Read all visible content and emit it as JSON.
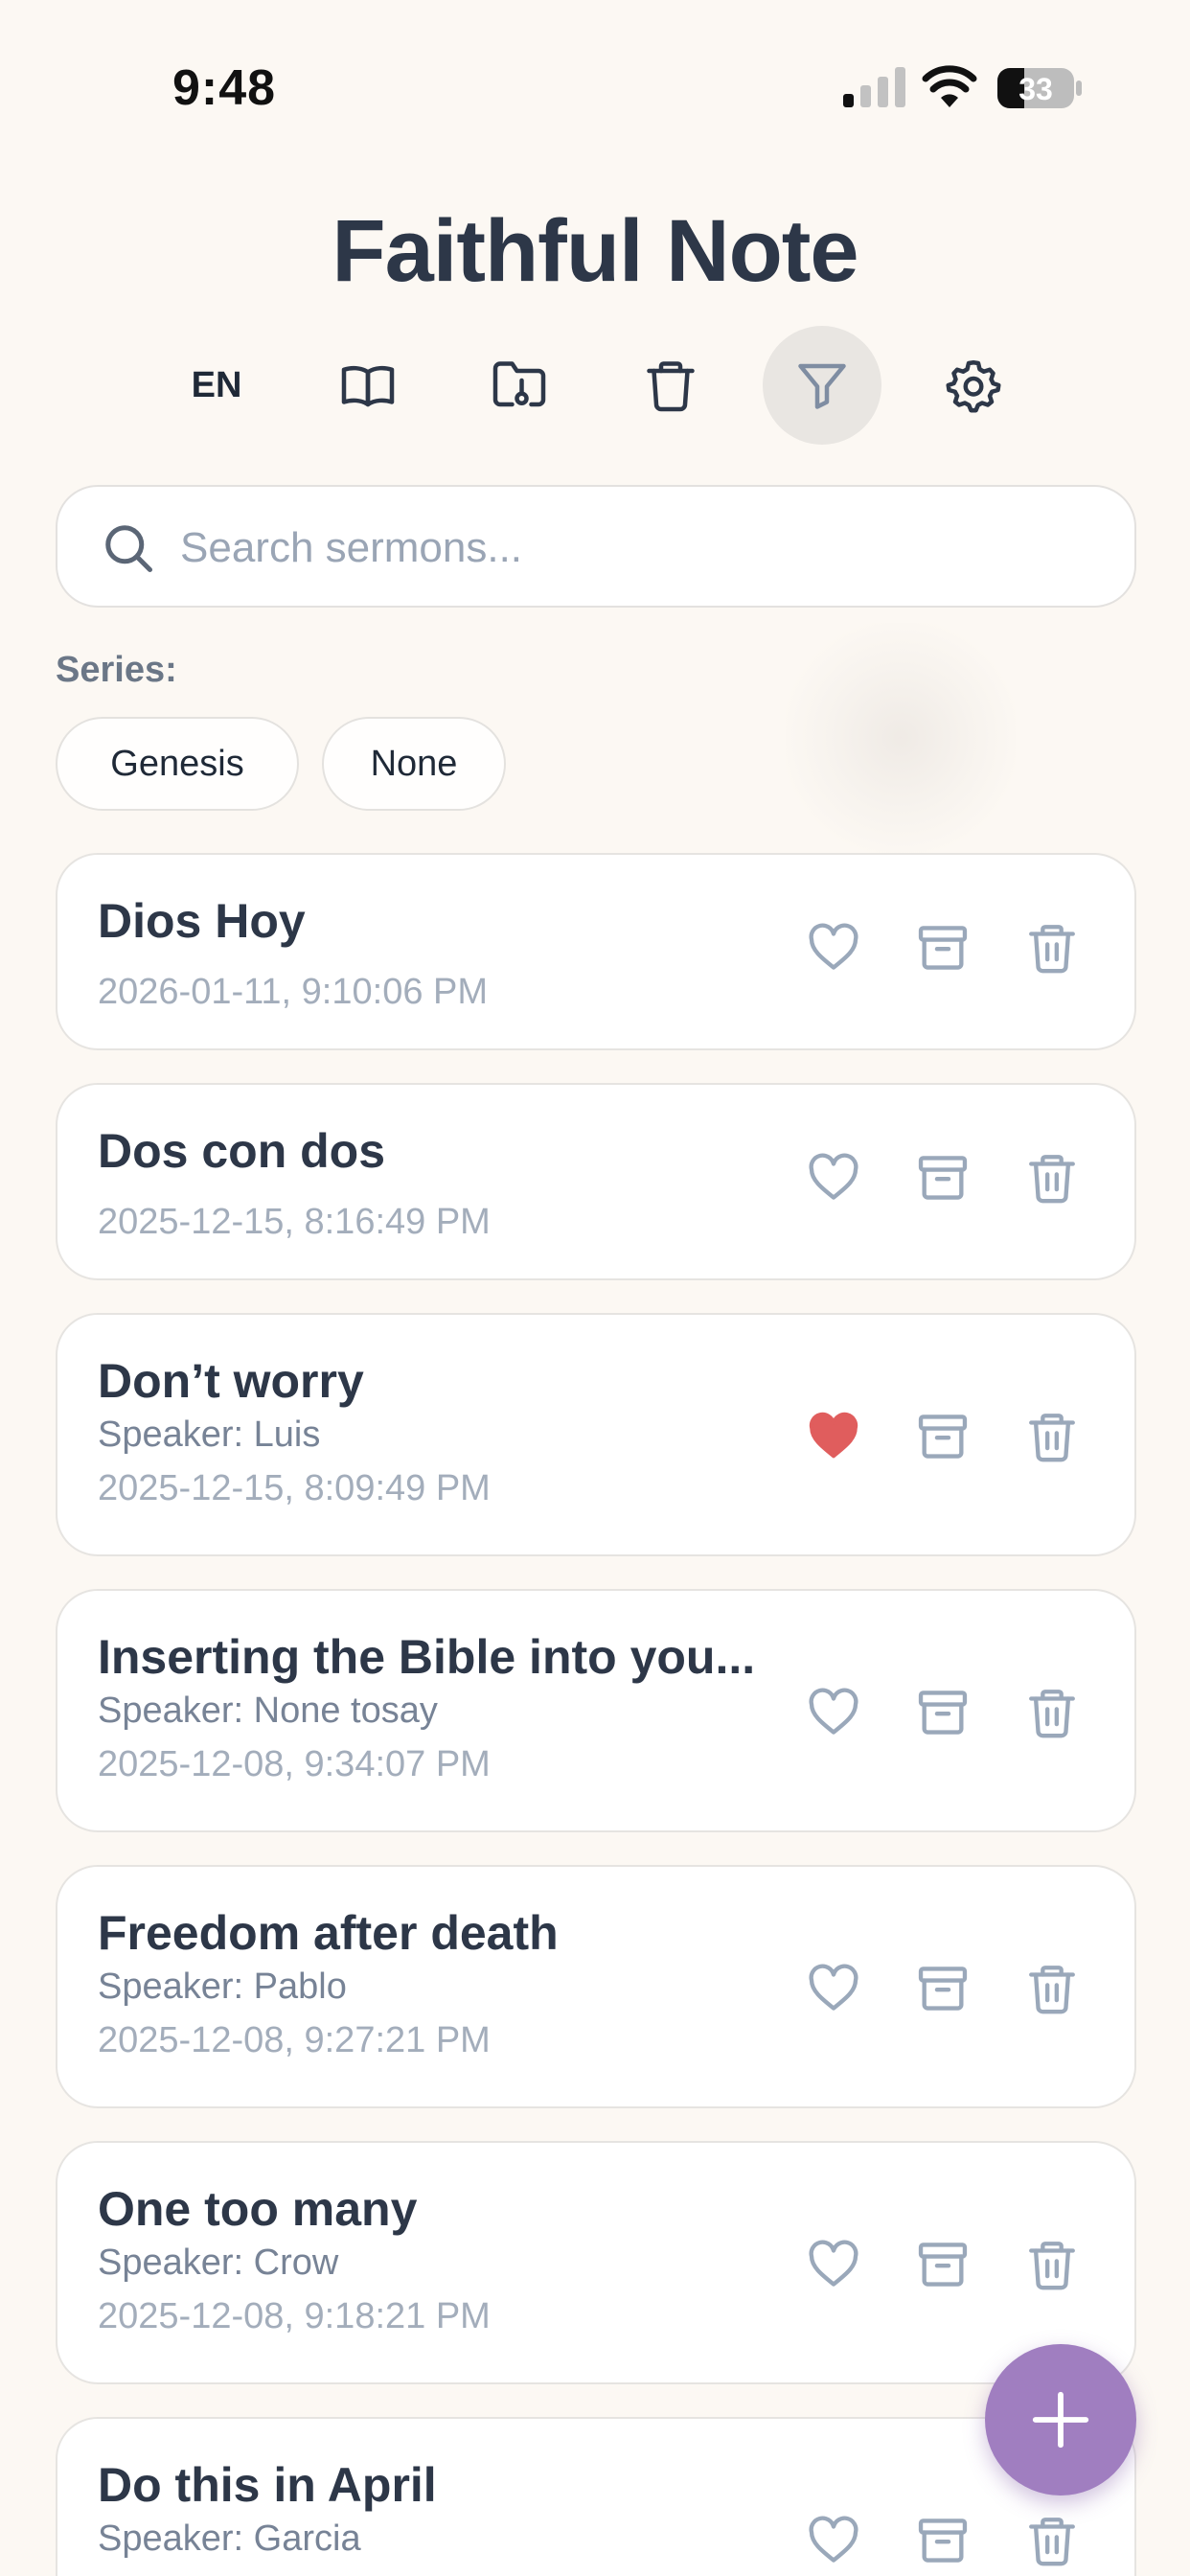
{
  "status_bar": {
    "time": "9:48",
    "battery_level": "33"
  },
  "header": {
    "title": "Faithful Note",
    "language": "EN",
    "toolbar_icons": [
      "book-icon",
      "folder-icon",
      "trash-icon",
      "filter-icon",
      "gear-icon"
    ],
    "active_tool": "filter-icon"
  },
  "search": {
    "placeholder": "Search sermons..."
  },
  "series": {
    "label": "Series:",
    "chips": [
      "Genesis",
      "None"
    ]
  },
  "sermons": [
    {
      "title": "Dios Hoy",
      "speaker": "",
      "date": "2026-01-11, 9:10:06 PM",
      "favorite": false
    },
    {
      "title": "Dos con dos",
      "speaker": "",
      "date": "2025-12-15, 8:16:49 PM",
      "favorite": false
    },
    {
      "title": "Don’t worry",
      "speaker": "Speaker: Luis",
      "date": "2025-12-15, 8:09:49 PM",
      "favorite": true
    },
    {
      "title": "Inserting the Bible into you...",
      "speaker": "Speaker: None tosay",
      "date": "2025-12-08, 9:34:07 PM",
      "favorite": false
    },
    {
      "title": "Freedom after death",
      "speaker": "Speaker: Pablo",
      "date": "2025-12-08, 9:27:21 PM",
      "favorite": false
    },
    {
      "title": "One too many",
      "speaker": "Speaker: Crow",
      "date": "2025-12-08, 9:18:21 PM",
      "favorite": false
    },
    {
      "title": "Do this in April",
      "speaker": "Speaker: Garcia",
      "date": "",
      "favorite": false
    }
  ],
  "colors": {
    "background": "#fcf8f3",
    "accent_fab": "#a07ec0",
    "favorite_heart": "#e05d5d",
    "icon_muted": "#9aa8ba",
    "title_text": "#2d3748"
  }
}
